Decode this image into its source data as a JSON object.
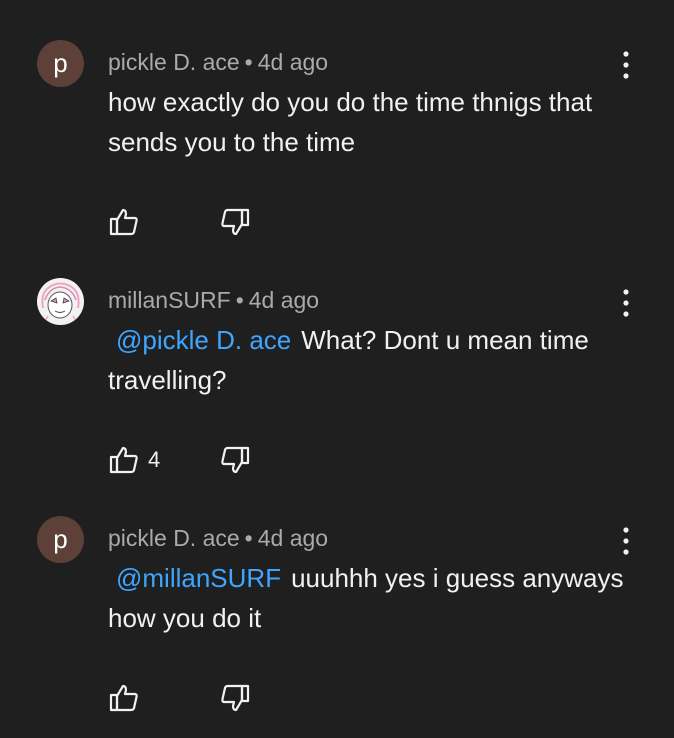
{
  "comments": [
    {
      "avatar_letter": "p",
      "author": "pickle D. ace",
      "separator": "•",
      "time": "4d ago",
      "mention": "",
      "text": "how exactly do you do the time thnigs that sends you to the time",
      "likes": ""
    },
    {
      "avatar_letter": "",
      "author": "millanSURF",
      "separator": "•",
      "time": "4d ago",
      "mention": "@pickle D. ace",
      "text": "What? Dont u mean time travelling?",
      "likes": "4"
    },
    {
      "avatar_letter": "p",
      "author": "pickle D. ace",
      "separator": "•",
      "time": "4d ago",
      "mention": "@millanSURF",
      "text": "uuuhhh yes i guess anyways how you do it",
      "likes": ""
    }
  ],
  "icons": {
    "like": "thumbs-up-icon",
    "dislike": "thumbs-down-icon",
    "menu": "more-vert-icon"
  },
  "colors": {
    "background": "#1f1f1f",
    "mention": "#3ea6ff",
    "meta_text": "#aaaaaa",
    "avatar_bg": "#5d4037"
  }
}
